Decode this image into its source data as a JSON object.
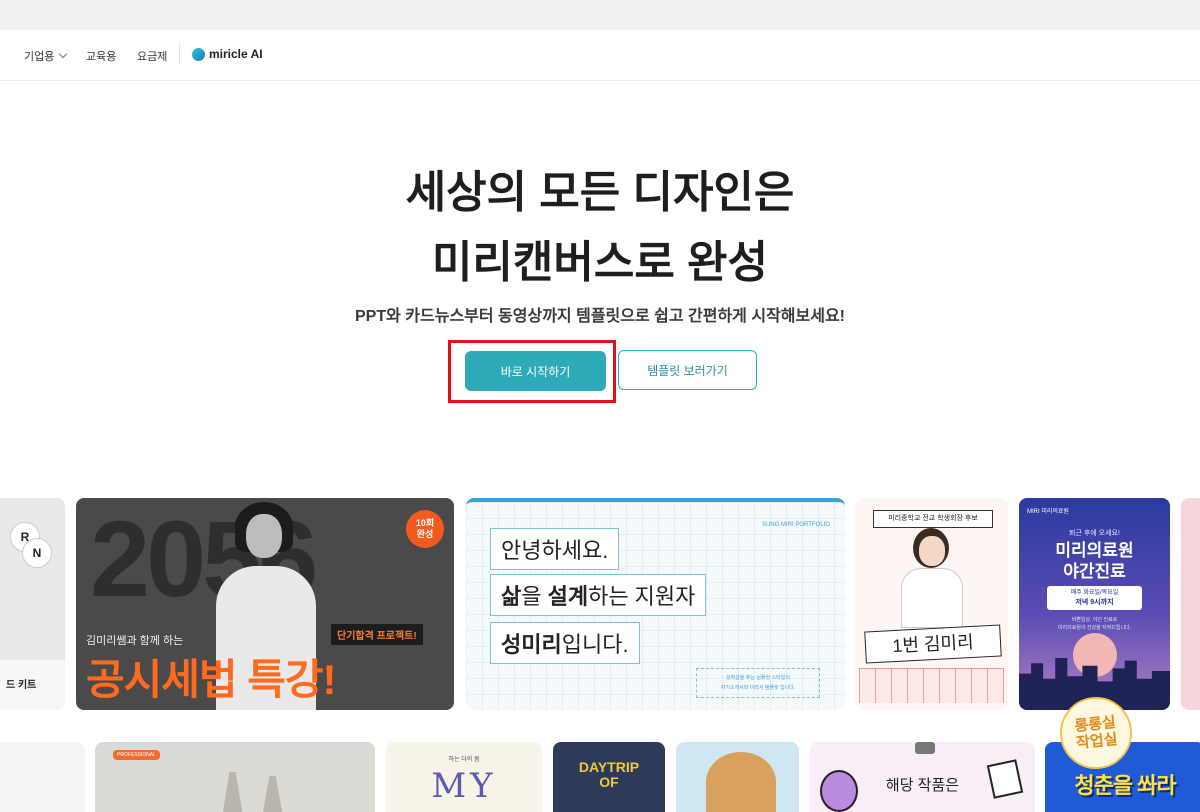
{
  "nav": {
    "items": [
      {
        "label": "기업용",
        "has_dropdown": true
      },
      {
        "label": "교육용",
        "has_dropdown": false
      },
      {
        "label": "요금제",
        "has_dropdown": false
      }
    ],
    "brand": "miricle AI",
    "brand_icon": "miricle-logo-icon"
  },
  "hero": {
    "title_line1": "세상의 모든 디자인은",
    "title_line2": "미리캔버스로 완성",
    "subtitle": "PPT와 카드뉴스부터 동영상까지 템플릿으로 쉽고 간편하게 시작해보세요!",
    "start_button": "바로 시작하기",
    "template_button": "템플릿 보러가기",
    "highlight_color": "#e3111b",
    "accent_color": "#2eaab8"
  },
  "cards_row1": [
    {
      "id": "kit",
      "circle1": "R",
      "circle2": "N",
      "label": "드 키트"
    },
    {
      "id": "lecture",
      "big_number": "2056",
      "badge_line1": "10회",
      "badge_line2": "완성",
      "small_text": "김미리쌤과 함께 하는",
      "tag": "단기합격 프로젝트!",
      "headline": "공시세법 특강!"
    },
    {
      "id": "portfolio",
      "header": "SUNG MIRI PORTFOLIO",
      "line1": "안녕하세요.",
      "line2_bold1": "삶",
      "line2_mid": "을 ",
      "line2_bold2": "설계",
      "line2_rest": "하는 지원자",
      "line3_bold": "성미리",
      "line3_rest": "입니다.",
      "note_line1": "성취감을 주는 심플한 스타일의",
      "note_line2": "자기소개서와 이력서 템플릿 입니다."
    },
    {
      "id": "student",
      "banner": "미리중학교 전교 학생회장 후보",
      "name": "1번 김미리"
    },
    {
      "id": "clinic",
      "logo": "MIRI 미리의료원",
      "small": "퇴근 후에 오세요!",
      "title_line1": "미리의료원",
      "title_line2": "야간진료",
      "pill_line1": "매주 화요일/목요일",
      "pill_line2": "저녁 9시까지",
      "desc_line1": "바쁜일상, 야간 진료로",
      "desc_line2": "미리의료원이 건강을 지켜드립니다."
    }
  ],
  "cards_row2": [
    {
      "id": "r2-tag",
      "tag": "PROFESSIONAL"
    },
    {
      "id": "r2-my",
      "small": "하는 다의 봄",
      "big": "MY"
    },
    {
      "id": "r2-daytrip",
      "line1": "DAYTRIP",
      "line2": "OF"
    },
    {
      "id": "r2-notice",
      "text": "해당 작품은"
    },
    {
      "id": "r2-youth",
      "text": "청춘을 쏴라"
    }
  ],
  "watermark": {
    "line1": "롱롱실",
    "line2": "작업실"
  }
}
